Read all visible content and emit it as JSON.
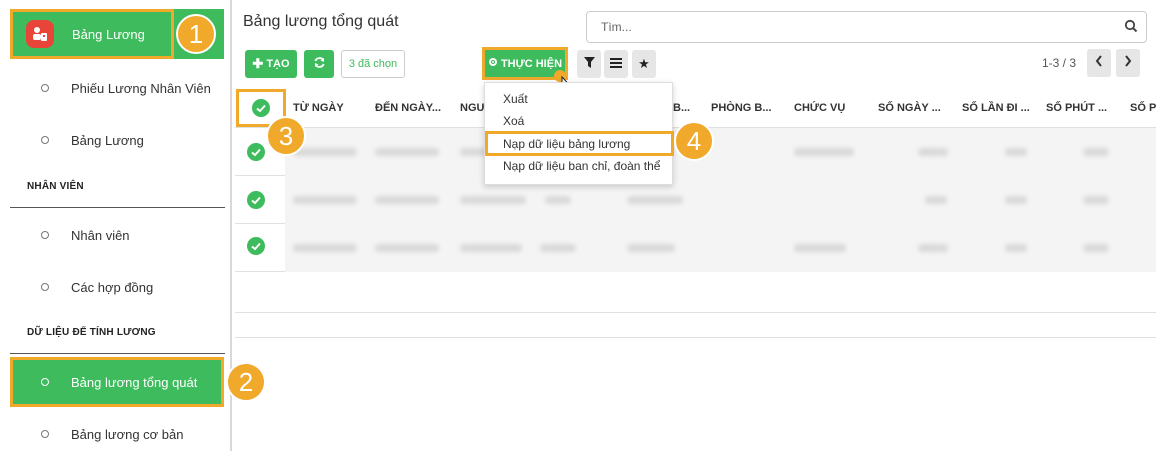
{
  "sidebar": {
    "top_item": "Bảng Lương",
    "sub_items": [
      "Phiếu Lương Nhân Viên",
      "Bảng Lương"
    ],
    "section_employee": "NHÂN VIÊN",
    "employee_items": [
      "Nhân viên",
      "Các hợp đồng"
    ],
    "section_data": "DỮ LIỆU ĐỂ TÍNH LƯƠNG",
    "data_items": [
      "Bảng lương tổng quát",
      "Bảng lương cơ bản"
    ]
  },
  "header": {
    "title": "Bảng lương tổng quát",
    "search_placeholder": "Tìm..."
  },
  "toolbar": {
    "create_label": "TẠO",
    "selected_label": "3 đã chọn",
    "action_label": "THỰC HIỆN",
    "pager": "1-3 / 3"
  },
  "table": {
    "columns": [
      "TỪ NGÀY",
      "ĐẾN NGÀY...",
      "NGƯ",
      "B...",
      "PHÒNG B...",
      "CHỨC VỤ",
      "SỐ NGÀY ...",
      "SỐ LẦN ĐI ...",
      "SỐ PHÚT ...",
      "SỐ P"
    ]
  },
  "dropdown": {
    "items": [
      "Xuất",
      "Xoá",
      "Nạp dữ liệu bảng lương",
      "Nạp dữ liệu ban chỉ, đoàn thể"
    ]
  },
  "badges": [
    "1",
    "2",
    "3",
    "4"
  ],
  "colors": {
    "green": "#3dbb5d",
    "orange": "#f0a92a",
    "red": "#e8443a"
  },
  "icons": [
    "app-icon",
    "search-icon",
    "plus-icon",
    "refresh-icon",
    "gear-icon",
    "filter-icon",
    "list-icon",
    "star-icon",
    "chevron-left-icon",
    "chevron-right-icon",
    "check-circle-icon",
    "cursor-icon"
  ]
}
